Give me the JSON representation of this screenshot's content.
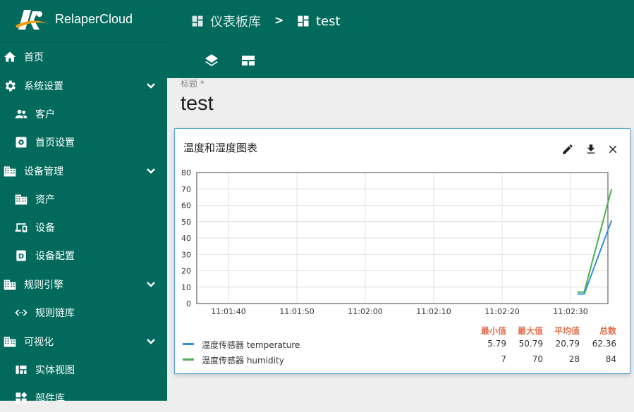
{
  "brand": {
    "name": "RelaperCloud"
  },
  "sidebar": {
    "items": [
      {
        "label": "首页",
        "icon": "home-icon"
      },
      {
        "label": "系统设置",
        "icon": "gear-icon"
      },
      {
        "label": "客户",
        "icon": "users-icon"
      },
      {
        "label": "首页设置",
        "icon": "settings-box-icon"
      },
      {
        "label": "设备管理",
        "icon": "building-icon"
      },
      {
        "label": "资产",
        "icon": "domain-icon"
      },
      {
        "label": "设备",
        "icon": "devices-icon"
      },
      {
        "label": "设备配置",
        "icon": "device-profile-icon"
      },
      {
        "label": "规则引擎",
        "icon": "building-icon"
      },
      {
        "label": "规则链库",
        "icon": "code-icon"
      },
      {
        "label": "可视化",
        "icon": "building-icon"
      },
      {
        "label": "实体视图",
        "icon": "view-quilt-icon"
      },
      {
        "label": "部件库",
        "icon": "widgets-icon"
      }
    ]
  },
  "breadcrumb": {
    "parent": "仪表板库",
    "separator": ">",
    "current": "test"
  },
  "dashboard": {
    "title_label": "标题 *",
    "title_value": "test"
  },
  "widget": {
    "title": "温度和湿度图表",
    "legend": {
      "headers": [
        "最小值",
        "最大值",
        "平均值",
        "总数"
      ],
      "rows": [
        {
          "name": "温度传感器 temperature",
          "color": "#2f8fdc",
          "min": "5.79",
          "max": "50.79",
          "avg": "20.79",
          "total": "62.36"
        },
        {
          "name": "温度传感器 humidity",
          "color": "#4caf50",
          "min": "7",
          "max": "70",
          "avg": "28",
          "total": "84"
        }
      ]
    }
  },
  "chart_data": {
    "type": "line",
    "x_ticks": [
      "11:01:40",
      "11:01:50",
      "11:02:00",
      "11:02:10",
      "11:02:20",
      "11:02:30"
    ],
    "y_ticks": [
      0,
      10,
      20,
      30,
      40,
      50,
      60,
      70,
      80
    ],
    "ylim": [
      0,
      80
    ],
    "grid": true,
    "series": [
      {
        "name": "温度传感器 temperature",
        "color": "#2f8fdc",
        "x": [
          "11:02:31",
          "11:02:32",
          "11:02:36"
        ],
        "values": [
          5.79,
          5.79,
          50.79
        ]
      },
      {
        "name": "温度传感器 humidity",
        "color": "#4caf50",
        "x": [
          "11:02:31",
          "11:02:32",
          "11:02:36"
        ],
        "values": [
          7,
          7,
          70
        ]
      }
    ]
  }
}
